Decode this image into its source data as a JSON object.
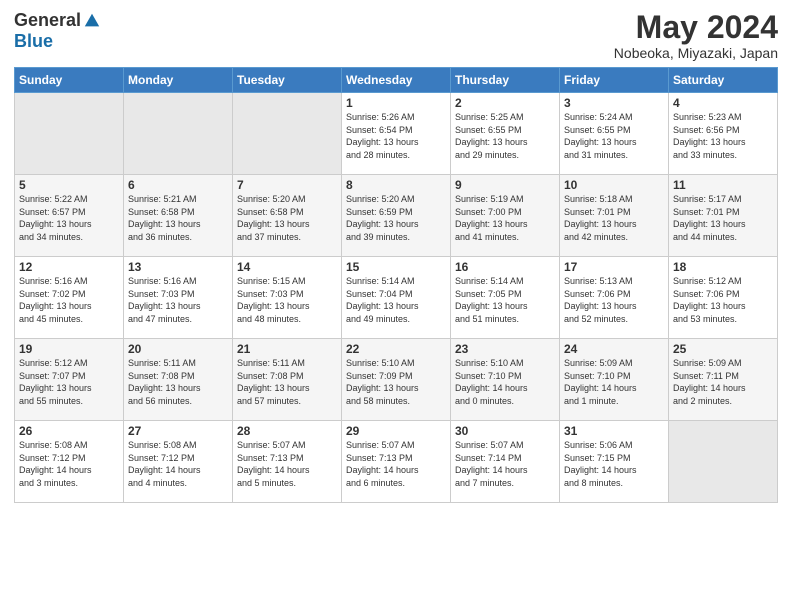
{
  "header": {
    "logo_general": "General",
    "logo_blue": "Blue",
    "month_title": "May 2024",
    "location": "Nobeoka, Miyazaki, Japan"
  },
  "days_of_week": [
    "Sunday",
    "Monday",
    "Tuesday",
    "Wednesday",
    "Thursday",
    "Friday",
    "Saturday"
  ],
  "weeks": [
    [
      {
        "day": "",
        "info": ""
      },
      {
        "day": "",
        "info": ""
      },
      {
        "day": "",
        "info": ""
      },
      {
        "day": "1",
        "info": "Sunrise: 5:26 AM\nSunset: 6:54 PM\nDaylight: 13 hours\nand 28 minutes."
      },
      {
        "day": "2",
        "info": "Sunrise: 5:25 AM\nSunset: 6:55 PM\nDaylight: 13 hours\nand 29 minutes."
      },
      {
        "day": "3",
        "info": "Sunrise: 5:24 AM\nSunset: 6:55 PM\nDaylight: 13 hours\nand 31 minutes."
      },
      {
        "day": "4",
        "info": "Sunrise: 5:23 AM\nSunset: 6:56 PM\nDaylight: 13 hours\nand 33 minutes."
      }
    ],
    [
      {
        "day": "5",
        "info": "Sunrise: 5:22 AM\nSunset: 6:57 PM\nDaylight: 13 hours\nand 34 minutes."
      },
      {
        "day": "6",
        "info": "Sunrise: 5:21 AM\nSunset: 6:58 PM\nDaylight: 13 hours\nand 36 minutes."
      },
      {
        "day": "7",
        "info": "Sunrise: 5:20 AM\nSunset: 6:58 PM\nDaylight: 13 hours\nand 37 minutes."
      },
      {
        "day": "8",
        "info": "Sunrise: 5:20 AM\nSunset: 6:59 PM\nDaylight: 13 hours\nand 39 minutes."
      },
      {
        "day": "9",
        "info": "Sunrise: 5:19 AM\nSunset: 7:00 PM\nDaylight: 13 hours\nand 41 minutes."
      },
      {
        "day": "10",
        "info": "Sunrise: 5:18 AM\nSunset: 7:01 PM\nDaylight: 13 hours\nand 42 minutes."
      },
      {
        "day": "11",
        "info": "Sunrise: 5:17 AM\nSunset: 7:01 PM\nDaylight: 13 hours\nand 44 minutes."
      }
    ],
    [
      {
        "day": "12",
        "info": "Sunrise: 5:16 AM\nSunset: 7:02 PM\nDaylight: 13 hours\nand 45 minutes."
      },
      {
        "day": "13",
        "info": "Sunrise: 5:16 AM\nSunset: 7:03 PM\nDaylight: 13 hours\nand 47 minutes."
      },
      {
        "day": "14",
        "info": "Sunrise: 5:15 AM\nSunset: 7:03 PM\nDaylight: 13 hours\nand 48 minutes."
      },
      {
        "day": "15",
        "info": "Sunrise: 5:14 AM\nSunset: 7:04 PM\nDaylight: 13 hours\nand 49 minutes."
      },
      {
        "day": "16",
        "info": "Sunrise: 5:14 AM\nSunset: 7:05 PM\nDaylight: 13 hours\nand 51 minutes."
      },
      {
        "day": "17",
        "info": "Sunrise: 5:13 AM\nSunset: 7:06 PM\nDaylight: 13 hours\nand 52 minutes."
      },
      {
        "day": "18",
        "info": "Sunrise: 5:12 AM\nSunset: 7:06 PM\nDaylight: 13 hours\nand 53 minutes."
      }
    ],
    [
      {
        "day": "19",
        "info": "Sunrise: 5:12 AM\nSunset: 7:07 PM\nDaylight: 13 hours\nand 55 minutes."
      },
      {
        "day": "20",
        "info": "Sunrise: 5:11 AM\nSunset: 7:08 PM\nDaylight: 13 hours\nand 56 minutes."
      },
      {
        "day": "21",
        "info": "Sunrise: 5:11 AM\nSunset: 7:08 PM\nDaylight: 13 hours\nand 57 minutes."
      },
      {
        "day": "22",
        "info": "Sunrise: 5:10 AM\nSunset: 7:09 PM\nDaylight: 13 hours\nand 58 minutes."
      },
      {
        "day": "23",
        "info": "Sunrise: 5:10 AM\nSunset: 7:10 PM\nDaylight: 14 hours\nand 0 minutes."
      },
      {
        "day": "24",
        "info": "Sunrise: 5:09 AM\nSunset: 7:10 PM\nDaylight: 14 hours\nand 1 minute."
      },
      {
        "day": "25",
        "info": "Sunrise: 5:09 AM\nSunset: 7:11 PM\nDaylight: 14 hours\nand 2 minutes."
      }
    ],
    [
      {
        "day": "26",
        "info": "Sunrise: 5:08 AM\nSunset: 7:12 PM\nDaylight: 14 hours\nand 3 minutes."
      },
      {
        "day": "27",
        "info": "Sunrise: 5:08 AM\nSunset: 7:12 PM\nDaylight: 14 hours\nand 4 minutes."
      },
      {
        "day": "28",
        "info": "Sunrise: 5:07 AM\nSunset: 7:13 PM\nDaylight: 14 hours\nand 5 minutes."
      },
      {
        "day": "29",
        "info": "Sunrise: 5:07 AM\nSunset: 7:13 PM\nDaylight: 14 hours\nand 6 minutes."
      },
      {
        "day": "30",
        "info": "Sunrise: 5:07 AM\nSunset: 7:14 PM\nDaylight: 14 hours\nand 7 minutes."
      },
      {
        "day": "31",
        "info": "Sunrise: 5:06 AM\nSunset: 7:15 PM\nDaylight: 14 hours\nand 8 minutes."
      },
      {
        "day": "",
        "info": ""
      }
    ]
  ]
}
